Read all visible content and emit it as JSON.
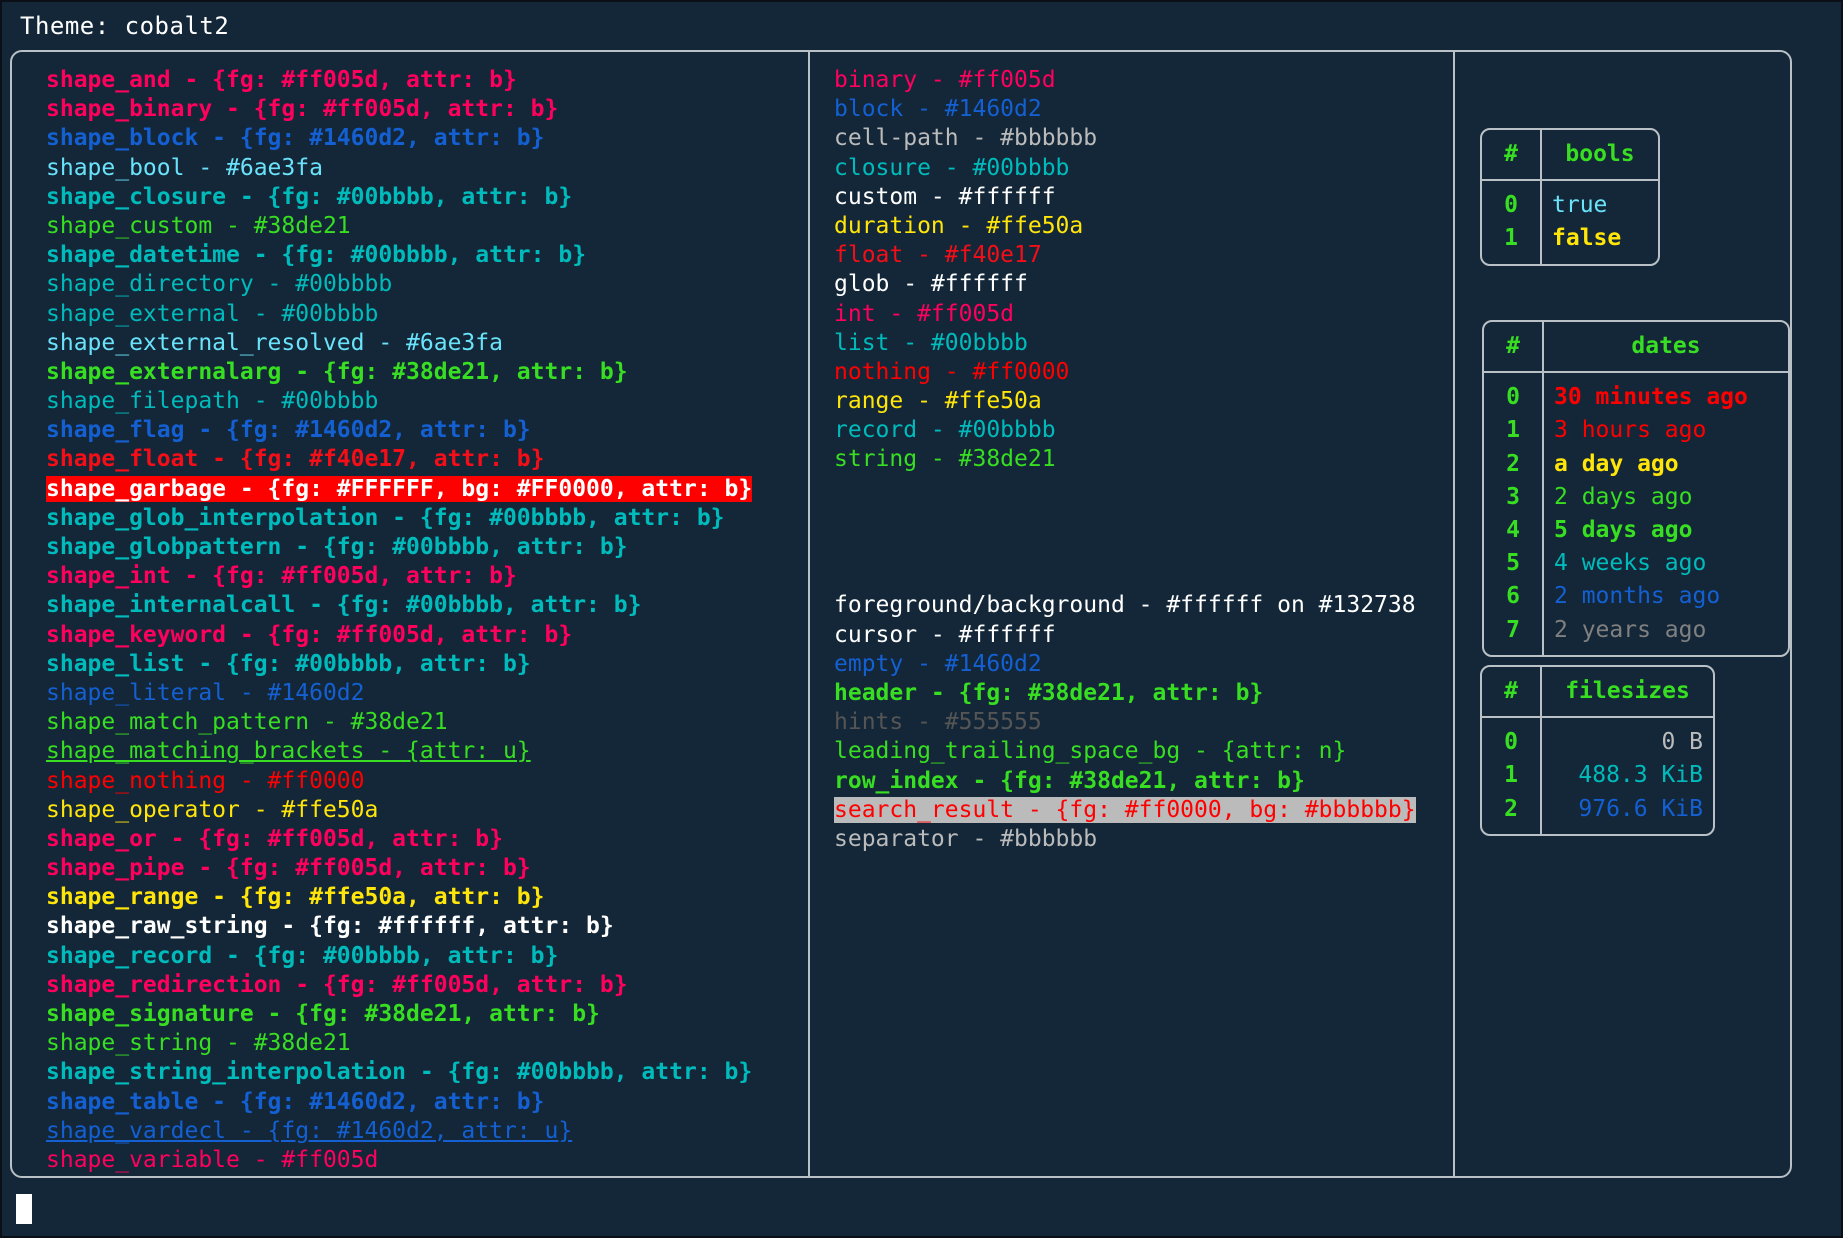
{
  "header": {
    "title": "Theme: cobalt2"
  },
  "palette": {
    "background": "#132738",
    "foreground": "#ffffff",
    "border": "#b9c0c6",
    "red": "#ff005d",
    "blue": "#1460d2",
    "lightblue": "#6ae3fa",
    "cyan": "#00bbbb",
    "green": "#38de21",
    "brightred": "#f40e17",
    "pure_red": "#ff0000",
    "yellow": "#ffe50a",
    "grey": "#bbbbbb",
    "darkgrey": "#555555",
    "white": "#ffffff"
  },
  "shapes_column": [
    {
      "text": "shape_and - {fg: #ff005d, attr: b}",
      "color": "#ff005d",
      "bold": true,
      "underline": false
    },
    {
      "text": "shape_binary - {fg: #ff005d, attr: b}",
      "color": "#ff005d",
      "bold": true,
      "underline": false
    },
    {
      "text": "shape_block - {fg: #1460d2, attr: b}",
      "color": "#1460d2",
      "bold": true,
      "underline": false
    },
    {
      "text": "shape_bool - #6ae3fa",
      "color": "#6ae3fa",
      "bold": false,
      "underline": false
    },
    {
      "text": "shape_closure - {fg: #00bbbb, attr: b}",
      "color": "#00bbbb",
      "bold": true,
      "underline": false
    },
    {
      "text": "shape_custom - #38de21",
      "color": "#38de21",
      "bold": false,
      "underline": false
    },
    {
      "text": "shape_datetime - {fg: #00bbbb, attr: b}",
      "color": "#00bbbb",
      "bold": true,
      "underline": false
    },
    {
      "text": "shape_directory - #00bbbb",
      "color": "#00bbbb",
      "bold": false,
      "underline": false
    },
    {
      "text": "shape_external - #00bbbb",
      "color": "#00bbbb",
      "bold": false,
      "underline": false
    },
    {
      "text": "shape_external_resolved - #6ae3fa",
      "color": "#6ae3fa",
      "bold": false,
      "underline": false
    },
    {
      "text": "shape_externalarg - {fg: #38de21, attr: b}",
      "color": "#38de21",
      "bold": true,
      "underline": false
    },
    {
      "text": "shape_filepath - #00bbbb",
      "color": "#00bbbb",
      "bold": false,
      "underline": false
    },
    {
      "text": "shape_flag - {fg: #1460d2, attr: b}",
      "color": "#1460d2",
      "bold": true,
      "underline": false
    },
    {
      "text": "shape_float - {fg: #f40e17, attr: b}",
      "color": "#f40e17",
      "bold": true,
      "underline": false
    },
    {
      "text": "shape_garbage - {fg: #FFFFFF, bg: #FF0000, attr: b}",
      "color": "#ffffff",
      "bg": "#ff0000",
      "bold": true,
      "underline": false
    },
    {
      "text": "shape_glob_interpolation - {fg: #00bbbb, attr: b}",
      "color": "#00bbbb",
      "bold": true,
      "underline": false
    },
    {
      "text": "shape_globpattern - {fg: #00bbbb, attr: b}",
      "color": "#00bbbb",
      "bold": true,
      "underline": false
    },
    {
      "text": "shape_int - {fg: #ff005d, attr: b}",
      "color": "#ff005d",
      "bold": true,
      "underline": false
    },
    {
      "text": "shape_internalcall - {fg: #00bbbb, attr: b}",
      "color": "#00bbbb",
      "bold": true,
      "underline": false
    },
    {
      "text": "shape_keyword - {fg: #ff005d, attr: b}",
      "color": "#ff005d",
      "bold": true,
      "underline": false
    },
    {
      "text": "shape_list - {fg: #00bbbb, attr: b}",
      "color": "#00bbbb",
      "bold": true,
      "underline": false
    },
    {
      "text": "shape_literal - #1460d2",
      "color": "#1460d2",
      "bold": false,
      "underline": false
    },
    {
      "text": "shape_match_pattern - #38de21",
      "color": "#38de21",
      "bold": false,
      "underline": false
    },
    {
      "text": "shape_matching_brackets - {attr: u}",
      "color": "#38de21",
      "bold": false,
      "underline": true
    },
    {
      "text": "shape_nothing - #ff0000",
      "color": "#ff0000",
      "bold": false,
      "underline": false
    },
    {
      "text": "shape_operator - #ffe50a",
      "color": "#ffe50a",
      "bold": false,
      "underline": false
    },
    {
      "text": "shape_or - {fg: #ff005d, attr: b}",
      "color": "#ff005d",
      "bold": true,
      "underline": false
    },
    {
      "text": "shape_pipe - {fg: #ff005d, attr: b}",
      "color": "#ff005d",
      "bold": true,
      "underline": false
    },
    {
      "text": "shape_range - {fg: #ffe50a, attr: b}",
      "color": "#ffe50a",
      "bold": true,
      "underline": false
    },
    {
      "text": "shape_raw_string - {fg: #ffffff, attr: b}",
      "color": "#ffffff",
      "bold": true,
      "underline": false
    },
    {
      "text": "shape_record - {fg: #00bbbb, attr: b}",
      "color": "#00bbbb",
      "bold": true,
      "underline": false
    },
    {
      "text": "shape_redirection - {fg: #ff005d, attr: b}",
      "color": "#ff005d",
      "bold": true,
      "underline": false
    },
    {
      "text": "shape_signature - {fg: #38de21, attr: b}",
      "color": "#38de21",
      "bold": true,
      "underline": false
    },
    {
      "text": "shape_string - #38de21",
      "color": "#38de21",
      "bold": false,
      "underline": false
    },
    {
      "text": "shape_string_interpolation - {fg: #00bbbb, attr: b}",
      "color": "#00bbbb",
      "bold": true,
      "underline": false
    },
    {
      "text": "shape_table - {fg: #1460d2, attr: b}",
      "color": "#1460d2",
      "bold": true,
      "underline": false
    },
    {
      "text": "shape_vardecl - {fg: #1460d2, attr: u}",
      "color": "#1460d2",
      "bold": false,
      "underline": true
    },
    {
      "text": "shape_variable - #ff005d",
      "color": "#ff005d",
      "bold": false,
      "underline": false
    }
  ],
  "types_column": [
    {
      "text": "binary - #ff005d",
      "color": "#ff005d",
      "bold": false,
      "underline": false
    },
    {
      "text": "block - #1460d2",
      "color": "#1460d2",
      "bold": false,
      "underline": false
    },
    {
      "text": "cell-path - #bbbbbb",
      "color": "#bbbbbb",
      "bold": false,
      "underline": false
    },
    {
      "text": "closure - #00bbbb",
      "color": "#00bbbb",
      "bold": false,
      "underline": false
    },
    {
      "text": "custom - #ffffff",
      "color": "#ffffff",
      "bold": false,
      "underline": false
    },
    {
      "text": "duration - #ffe50a",
      "color": "#ffe50a",
      "bold": false,
      "underline": false
    },
    {
      "text": "float - #f40e17",
      "color": "#f40e17",
      "bold": false,
      "underline": false
    },
    {
      "text": "glob - #ffffff",
      "color": "#ffffff",
      "bold": false,
      "underline": false
    },
    {
      "text": "int - #ff005d",
      "color": "#ff005d",
      "bold": false,
      "underline": false
    },
    {
      "text": "list - #00bbbb",
      "color": "#00bbbb",
      "bold": false,
      "underline": false
    },
    {
      "text": "nothing - #ff0000",
      "color": "#ff0000",
      "bold": false,
      "underline": false
    },
    {
      "text": "range - #ffe50a",
      "color": "#ffe50a",
      "bold": false,
      "underline": false
    },
    {
      "text": "record - #00bbbb",
      "color": "#00bbbb",
      "bold": false,
      "underline": false
    },
    {
      "text": "string - #38de21",
      "color": "#38de21",
      "bold": false,
      "underline": false
    },
    {
      "text": "",
      "color": "#ffffff",
      "bold": false,
      "underline": false
    },
    {
      "text": "",
      "color": "#ffffff",
      "bold": false,
      "underline": false
    },
    {
      "text": "",
      "color": "#ffffff",
      "bold": false,
      "underline": false
    },
    {
      "text": "",
      "color": "#ffffff",
      "bold": false,
      "underline": false
    },
    {
      "text": "foreground/background - #ffffff on #132738",
      "color": "#ffffff",
      "bold": false,
      "underline": false
    },
    {
      "text": "cursor - #ffffff",
      "color": "#ffffff",
      "bold": false,
      "underline": false
    },
    {
      "text": "empty - #1460d2",
      "color": "#1460d2",
      "bold": false,
      "underline": false
    },
    {
      "text": "header - {fg: #38de21, attr: b}",
      "color": "#38de21",
      "bold": true,
      "underline": false
    },
    {
      "text": "hints - #555555",
      "color": "#555555",
      "bold": false,
      "underline": false
    },
    {
      "text": "leading_trailing_space_bg - {attr: n}",
      "color": "#38de21",
      "bold": false,
      "underline": false
    },
    {
      "text": "row_index - {fg: #38de21, attr: b}",
      "color": "#38de21",
      "bold": true,
      "underline": false
    },
    {
      "text": "search_result - {fg: #ff0000, bg: #bbbbbb}",
      "color": "#ff0000",
      "bg": "#bbbbbb",
      "bold": false,
      "underline": false
    },
    {
      "text": "separator - #bbbbbb",
      "color": "#bbbbbb",
      "bold": false,
      "underline": false
    }
  ],
  "tables": {
    "bools": {
      "headers": [
        "#",
        "bools"
      ],
      "rows": [
        {
          "index": "0",
          "value": "true",
          "color": "#6ae3fa",
          "bold": false
        },
        {
          "index": "1",
          "value": "false",
          "color": "#ffe50a",
          "bold": true
        }
      ]
    },
    "dates": {
      "headers": [
        "#",
        "dates"
      ],
      "rows": [
        {
          "index": "0",
          "value": "30 minutes ago",
          "color": "#ff0000",
          "bold": true
        },
        {
          "index": "1",
          "value": "3 hours ago",
          "color": "#ff0000",
          "bold": false
        },
        {
          "index": "2",
          "value": "a day ago",
          "color": "#ffe50a",
          "bold": true
        },
        {
          "index": "3",
          "value": "2 days ago",
          "color": "#38de21",
          "bold": false
        },
        {
          "index": "4",
          "value": "5 days ago",
          "color": "#38de21",
          "bold": true
        },
        {
          "index": "5",
          "value": "4 weeks ago",
          "color": "#00bbbb",
          "bold": false
        },
        {
          "index": "6",
          "value": "2 months ago",
          "color": "#1460d2",
          "bold": false
        },
        {
          "index": "7",
          "value": "2 years ago",
          "color": "#808080",
          "bold": false
        }
      ]
    },
    "filesizes": {
      "headers": [
        "#",
        "filesizes"
      ],
      "rows": [
        {
          "index": "0",
          "value": "0 B",
          "color": "#bbbbbb",
          "bold": false
        },
        {
          "index": "1",
          "value": "488.3 KiB",
          "color": "#00bbbb",
          "bold": false
        },
        {
          "index": "2",
          "value": "976.6 KiB",
          "color": "#1460d2",
          "bold": false
        }
      ]
    }
  }
}
